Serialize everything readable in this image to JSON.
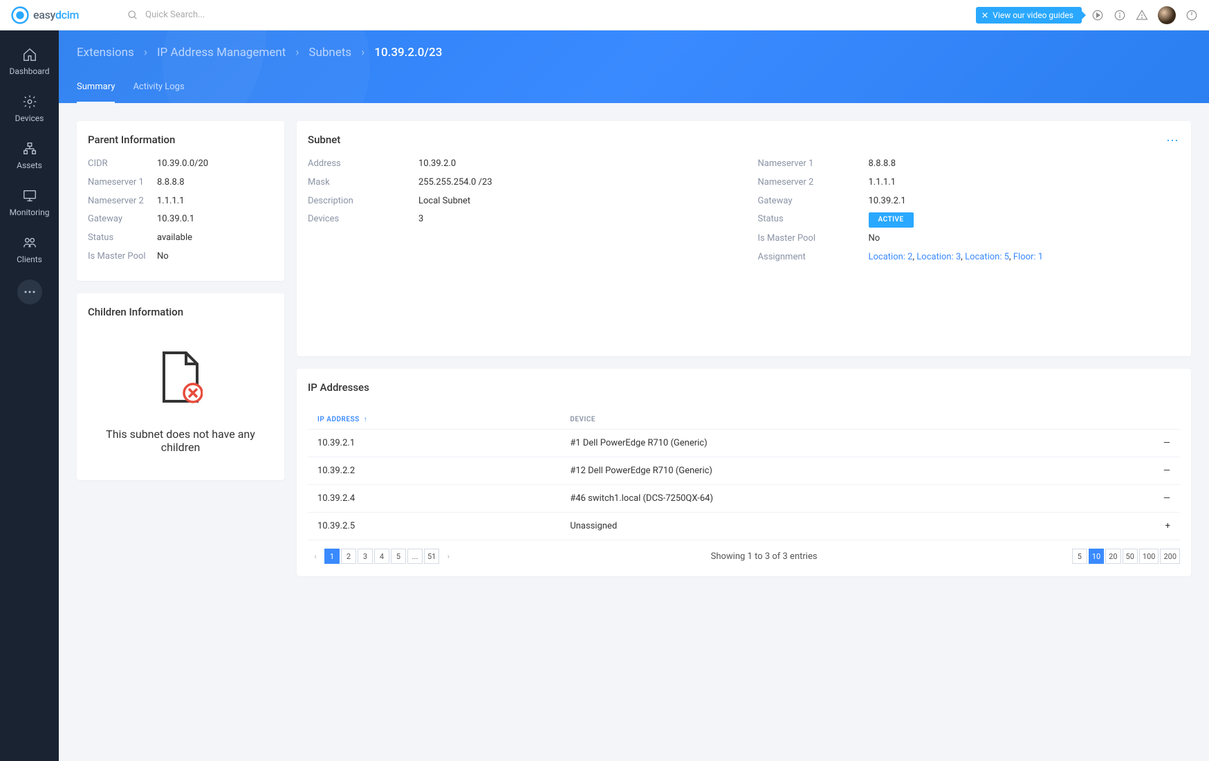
{
  "brand": {
    "text1": "easy",
    "text2": "dcim"
  },
  "search": {
    "placeholder": "Quick Search..."
  },
  "video_guide": "View our video guides",
  "sidebar": [
    {
      "label": "Dashboard",
      "icon": "home"
    },
    {
      "label": "Devices",
      "icon": "gear"
    },
    {
      "label": "Assets",
      "icon": "org"
    },
    {
      "label": "Monitoring",
      "icon": "monitor"
    },
    {
      "label": "Clients",
      "icon": "users"
    }
  ],
  "breadcrumb": {
    "a": "Extensions",
    "b": "IP Address Management",
    "c": "Subnets",
    "d": "10.39.2.0/23"
  },
  "tabs": {
    "summary": "Summary",
    "activity": "Activity Logs"
  },
  "parent": {
    "title": "Parent Information",
    "cidr_k": "CIDR",
    "cidr_v": "10.39.0.0/20",
    "ns1_k": "Nameserver 1",
    "ns1_v": "8.8.8.8",
    "ns2_k": "Nameserver 2",
    "ns2_v": "1.1.1.1",
    "gw_k": "Gateway",
    "gw_v": "10.39.0.1",
    "st_k": "Status",
    "st_v": "available",
    "mp_k": "Is Master Pool",
    "mp_v": "No"
  },
  "children": {
    "title": "Children Information",
    "empty": "This subnet does not have any children"
  },
  "subnet": {
    "title": "Subnet",
    "addr_k": "Address",
    "addr_v": "10.39.2.0",
    "mask_k": "Mask",
    "mask_v": "255.255.254.0 /23",
    "desc_k": "Description",
    "desc_v": "Local Subnet",
    "dev_k": "Devices",
    "dev_v": "3",
    "ns1_k": "Nameserver 1",
    "ns1_v": "8.8.8.8",
    "ns2_k": "Nameserver 2",
    "ns2_v": "1.1.1.1",
    "gw_k": "Gateway",
    "gw_v": "10.39.2.1",
    "st_k": "Status",
    "st_v": "ACTIVE",
    "mp_k": "Is Master Pool",
    "mp_v": "No",
    "as_k": "Assignment",
    "assignments": [
      "Location: 2",
      "Location: 3",
      "Location: 5",
      "Floor: 1"
    ]
  },
  "ip": {
    "title": "IP Addresses",
    "col_ip": "IP ADDRESS",
    "col_dev": "DEVICE",
    "rows": [
      {
        "ip": "10.39.2.1",
        "device": "#1 Dell PowerEdge R710 (Generic)",
        "assigned": true
      },
      {
        "ip": "10.39.2.2",
        "device": "#12 Dell PowerEdge R710 (Generic)",
        "assigned": true
      },
      {
        "ip": "10.39.2.4",
        "device": "#46 switch1.local (DCS-7250QX-64)",
        "assigned": true
      },
      {
        "ip": "10.39.2.5",
        "device": "Unassigned",
        "assigned": false
      }
    ],
    "pages": [
      "1",
      "2",
      "3",
      "4",
      "5",
      "...",
      "51"
    ],
    "showing": "Showing 1 to 3 of 3 entries",
    "sizes": [
      "5",
      "10",
      "20",
      "50",
      "100",
      "200"
    ],
    "active_page": "1",
    "active_size": "10"
  }
}
